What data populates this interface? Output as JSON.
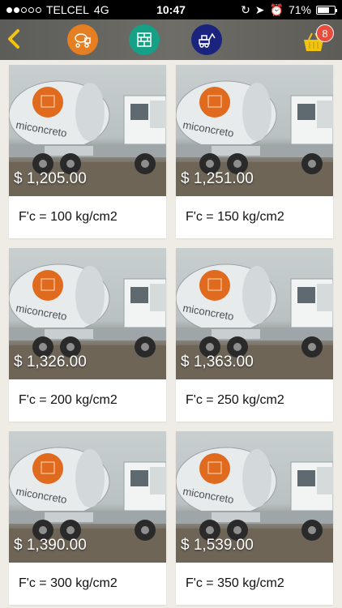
{
  "status_bar": {
    "carrier": "TELCEL",
    "network": "4G",
    "time": "10:47",
    "battery": "71%",
    "battery_level": 0.71
  },
  "header": {
    "back_icon": "chevron-left-icon",
    "buttons": [
      {
        "name": "concrete-mixer-category-button",
        "icon": "mixer-truck-icon",
        "color": "#e67e22"
      },
      {
        "name": "blocks-category-button",
        "icon": "brick-wall-icon",
        "color": "#16a085"
      },
      {
        "name": "machinery-category-button",
        "icon": "excavator-icon",
        "color": "#1a237e"
      }
    ],
    "cart_count": "8",
    "cart_color": "#f1c40f",
    "badge_color": "#e74c3c"
  },
  "image_brand": "miconcreto",
  "products": [
    {
      "price": "$ 1,205.00",
      "title": "F'c = 100 kg/cm2"
    },
    {
      "price": "$ 1,251.00",
      "title": "F'c = 150 kg/cm2"
    },
    {
      "price": "$ 1,326.00",
      "title": "F'c = 200 kg/cm2"
    },
    {
      "price": "$ 1,363.00",
      "title": "F'c = 250 kg/cm2"
    },
    {
      "price": "$ 1,390.00",
      "title": "F'c = 300 kg/cm2"
    },
    {
      "price": "$ 1,539.00",
      "title": "F'c = 350 kg/cm2"
    }
  ]
}
